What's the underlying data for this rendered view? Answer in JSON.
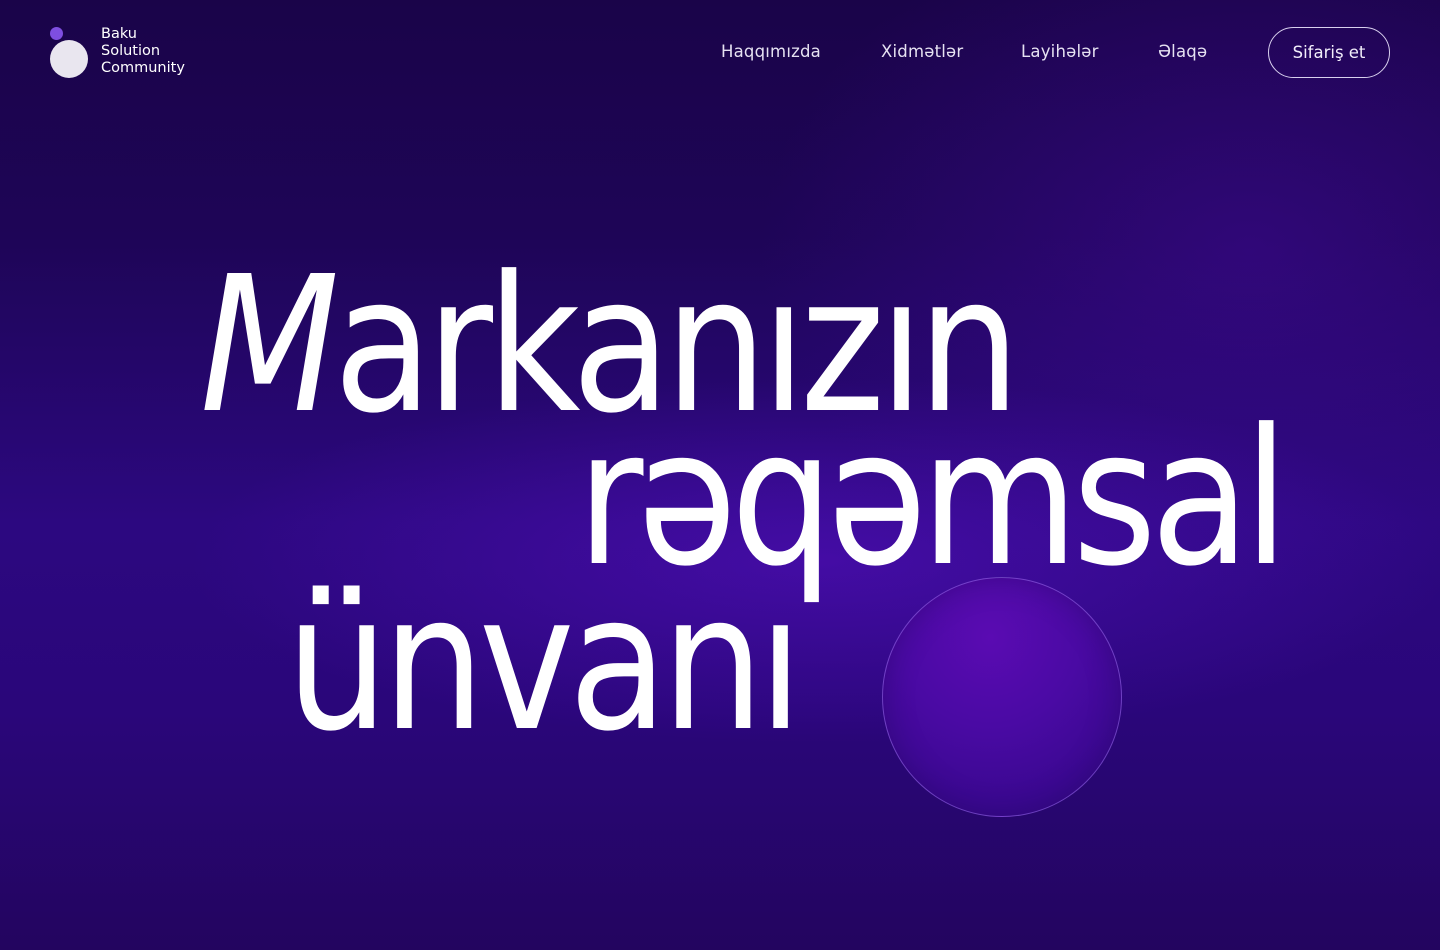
{
  "brand": {
    "lines": [
      "Baku",
      "Solution",
      "Community"
    ]
  },
  "nav": {
    "items": [
      {
        "label": "Haqqımızda"
      },
      {
        "label": "Xidmətlər"
      },
      {
        "label": "Layihələr"
      },
      {
        "label": "Əlaqə"
      }
    ],
    "cta_label": "Sifariş et"
  },
  "hero": {
    "line1_first": "M",
    "line1_rest": "arkanızın",
    "line2": "rəqəmsal",
    "line3": "ünvanı"
  },
  "colors": {
    "background": "#2a067a",
    "accent": "#7e4ee0",
    "text": "#ffffff"
  },
  "icons": {
    "logo_mark": "logo-mark-icon"
  }
}
